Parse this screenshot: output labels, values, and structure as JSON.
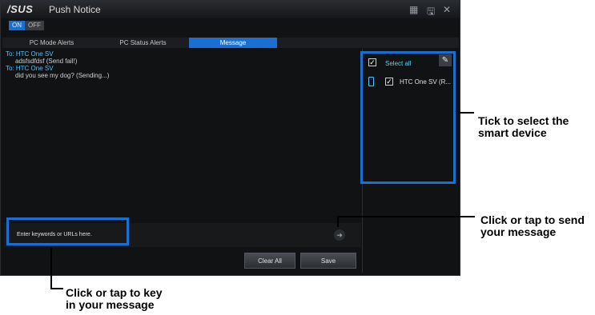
{
  "app": {
    "logo": "/SUS",
    "title": "Push Notice",
    "window_controls": [
      "grid-icon",
      "save-icon",
      "close-icon"
    ]
  },
  "toggle": {
    "on": "ON",
    "off": "OFF"
  },
  "tabs": [
    {
      "label": "PC Mode Alerts",
      "active": false
    },
    {
      "label": "PC Status Alerts",
      "active": false
    },
    {
      "label": "Message",
      "active": true
    }
  ],
  "messages": [
    {
      "to": "To: HTC One SV",
      "text": "adsfsdfdsf   (Send fail!)"
    },
    {
      "to": "To: HTC One SV",
      "text": "did you see my dog?   (Sending...)"
    }
  ],
  "device_panel": {
    "select_all": "Select all",
    "devices": [
      {
        "name": "HTC One SV (R...",
        "checked": true
      }
    ]
  },
  "input": {
    "placeholder": "Enter keywords or URLs here."
  },
  "buttons": {
    "clear_all": "Clear All",
    "save": "Save"
  },
  "annotations": {
    "select_device": [
      "Tick to select the",
      "smart device"
    ],
    "send": [
      "Click or tap to send",
      "your message"
    ],
    "key_in": [
      "Click or tap to key",
      "in your message"
    ]
  },
  "colors": {
    "accent": "#1a6fd0",
    "highlight_cyan": "#52c3ff"
  }
}
